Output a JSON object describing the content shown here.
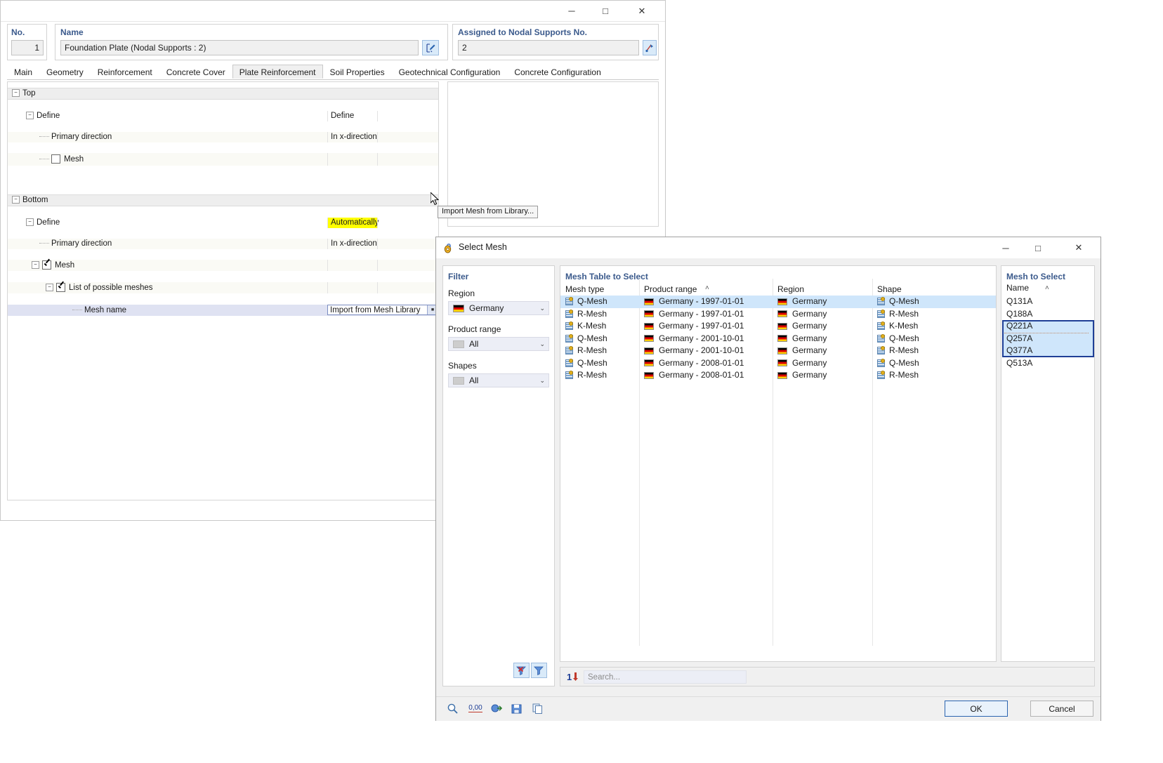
{
  "main_window": {
    "window_controls": {
      "minimize": "─",
      "maximize": "□",
      "close": "✕"
    },
    "no_label": "No.",
    "no_value": "1",
    "name_label": "Name",
    "name_value": "Foundation Plate (Nodal Supports : 2)",
    "name_edit_icon": "edit-pencil-icon",
    "nodal_label": "Assigned to Nodal Supports No.",
    "nodal_value": "2",
    "nodal_pick_icon": "pick-object-icon",
    "tabs": [
      {
        "label": "Main",
        "active": false
      },
      {
        "label": "Geometry",
        "active": false
      },
      {
        "label": "Reinforcement",
        "active": false
      },
      {
        "label": "Concrete Cover",
        "active": false
      },
      {
        "label": "Plate Reinforcement",
        "active": true
      },
      {
        "label": "Soil Properties",
        "active": false
      },
      {
        "label": "Geotechnical Configuration",
        "active": false
      },
      {
        "label": "Concrete Configuration",
        "active": false
      }
    ],
    "tree": {
      "top_group": "Top",
      "top_define_label": "Define",
      "top_define_value": "Define",
      "top_primary_label": "Primary direction",
      "top_primary_value": "In x-direction",
      "top_mesh_label": "Mesh",
      "bottom_group": "Bottom",
      "bottom_define_label": "Define",
      "bottom_define_value": "Automatically",
      "bottom_primary_label": "Primary direction",
      "bottom_primary_value": "In x-direction",
      "bottom_mesh_label": "Mesh",
      "bottom_list_label": "List of possible meshes",
      "mesh_name_label": "Mesh name",
      "mesh_name_value": "Import from Mesh Library",
      "highlight_color": "#ffff00"
    },
    "tooltip": "Import Mesh from Library..."
  },
  "dialog": {
    "title": "Select Mesh",
    "icon": "mesh-library-icon",
    "window_controls": {
      "minimize": "─",
      "maximize": "□",
      "close": "✕"
    },
    "filter": {
      "title": "Filter",
      "region_label": "Region",
      "region_value": "Germany",
      "region_icon": "germany-flag-icon",
      "product_range_label": "Product range",
      "product_range_value": "All",
      "shapes_label": "Shapes",
      "shapes_value": "All",
      "arrow": "⌄",
      "tools": [
        {
          "name": "clear-filter-icon",
          "glyph": "✖"
        },
        {
          "name": "apply-filter-icon",
          "glyph": "▼"
        }
      ]
    },
    "mesh_table": {
      "title": "Mesh Table to Select",
      "sort_indicator": "˄",
      "sorted_column": "Product range",
      "columns": [
        "Mesh type",
        "Product range",
        "Region",
        "Shape"
      ],
      "rows": [
        {
          "mesh_type": "Q-Mesh",
          "product_range": "Germany - 1997-01-01",
          "region": "Germany",
          "shape": "Q-Mesh",
          "selected": true
        },
        {
          "mesh_type": "R-Mesh",
          "product_range": "Germany - 1997-01-01",
          "region": "Germany",
          "shape": "R-Mesh",
          "selected": false
        },
        {
          "mesh_type": "K-Mesh",
          "product_range": "Germany - 1997-01-01",
          "region": "Germany",
          "shape": "K-Mesh",
          "selected": false
        },
        {
          "mesh_type": "Q-Mesh",
          "product_range": "Germany - 2001-10-01",
          "region": "Germany",
          "shape": "Q-Mesh",
          "selected": false
        },
        {
          "mesh_type": "R-Mesh",
          "product_range": "Germany - 2001-10-01",
          "region": "Germany",
          "shape": "R-Mesh",
          "selected": false
        },
        {
          "mesh_type": "Q-Mesh",
          "product_range": "Germany - 2008-01-01",
          "region": "Germany",
          "shape": "Q-Mesh",
          "selected": false
        },
        {
          "mesh_type": "R-Mesh",
          "product_range": "Germany - 2008-01-01",
          "region": "Germany",
          "shape": "R-Mesh",
          "selected": false
        }
      ]
    },
    "mesh_to_select": {
      "title": "Mesh to Select",
      "column": "Name",
      "sort_indicator": "˄",
      "items": [
        {
          "name": "Q131A",
          "selected": false
        },
        {
          "name": "Q188A",
          "selected": false
        },
        {
          "name": "Q221A",
          "selected": true
        },
        {
          "name": "Q257A",
          "selected": true
        },
        {
          "name": "Q377A",
          "selected": true
        },
        {
          "name": "Q513A",
          "selected": false
        }
      ],
      "selection_border_color": "#1f3f96",
      "selection_fill_color": "#cfe6fb"
    },
    "search": {
      "icon": "sort-ascending-icon",
      "placeholder": "Search..."
    },
    "footer": {
      "tools": [
        {
          "name": "zoom-info-icon",
          "glyph": "⌕"
        },
        {
          "name": "units-decimal-icon",
          "glyph": "0,00"
        },
        {
          "name": "import-icon",
          "glyph": "⇲"
        },
        {
          "name": "save-icon",
          "glyph": "Ὃe"
        },
        {
          "name": "copy-icon",
          "glyph": "⧉"
        }
      ],
      "ok_label": "OK",
      "cancel_label": "Cancel"
    }
  }
}
